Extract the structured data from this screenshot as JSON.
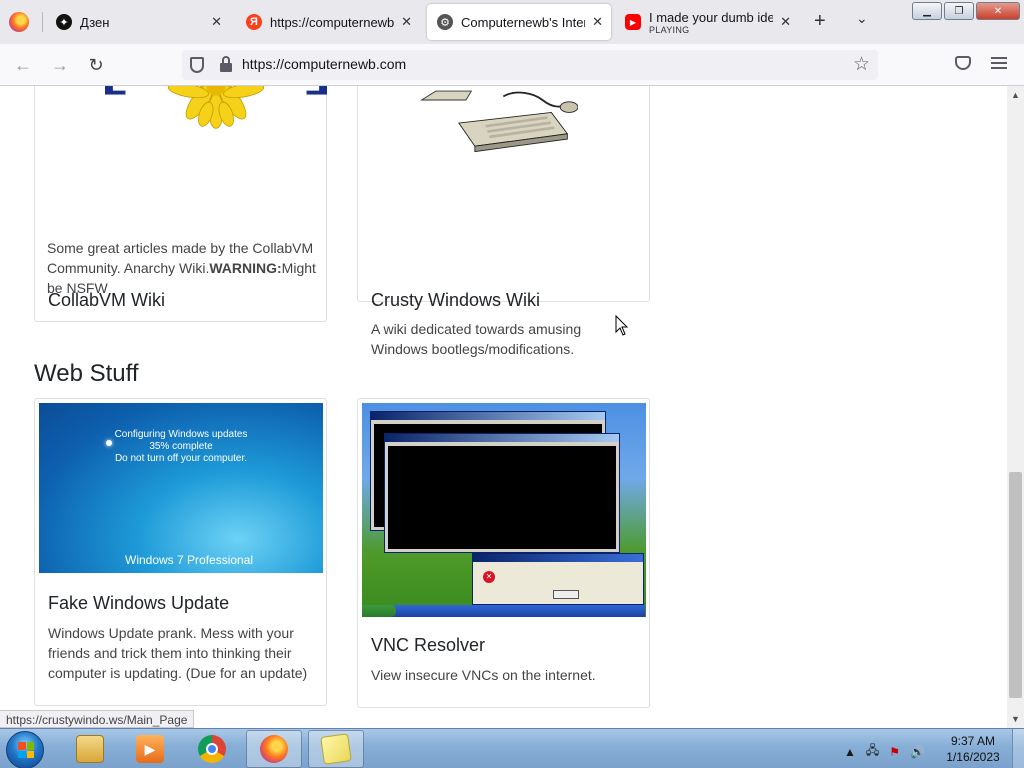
{
  "browser": {
    "tabs": [
      {
        "title": "Дзен",
        "favicon": "dzen-icon",
        "active": false
      },
      {
        "title": "https://computernewb.c",
        "favicon": "yandex-icon",
        "active": false
      },
      {
        "title": "Computernewb's Interne",
        "favicon": "computernewb-icon",
        "active": true
      },
      {
        "title": "I made your dumb ideas",
        "subtitle": "PLAYING",
        "favicon": "youtube-icon",
        "active": false
      }
    ],
    "url": "https://computernewb.com",
    "status_url": "https://crustywindo.ws/Main_Page"
  },
  "page": {
    "cards_top": [
      {
        "title": "CollabVM Wiki",
        "desc": "Some great articles made by the CollabVM Community. Anarchy Wiki.",
        "warning_label": "WARNING:",
        "warning_text": "Might be NSFW"
      },
      {
        "title": "Crusty Windows Wiki",
        "desc": "A wiki dedicated towards amusing Windows bootlegs/modifications."
      }
    ],
    "section_web": "Web Stuff",
    "cards_web": [
      {
        "title": "Fake Windows Update",
        "desc": "Windows Update prank. Mess with your friends and trick them into thinking their computer is updating. (Due for an update)",
        "image": {
          "line1": "Configuring Windows updates",
          "line2": "35% complete",
          "line3": "Do not turn off your computer.",
          "brand": "Windows 7 Professional"
        }
      },
      {
        "title": "VNC Resolver",
        "desc": "View insecure VNCs on the internet."
      }
    ]
  },
  "taskbar": {
    "time": "9:37 AM",
    "date": "1/16/2023",
    "pinned": [
      "explorer-icon",
      "media-player-icon",
      "chrome-icon",
      "firefox-icon",
      "sticky-notes-icon"
    ]
  },
  "colors": {
    "tab_bg": "#e8e8ed",
    "card_border": "#dfdfdf",
    "taskbar": "#86aed6"
  }
}
